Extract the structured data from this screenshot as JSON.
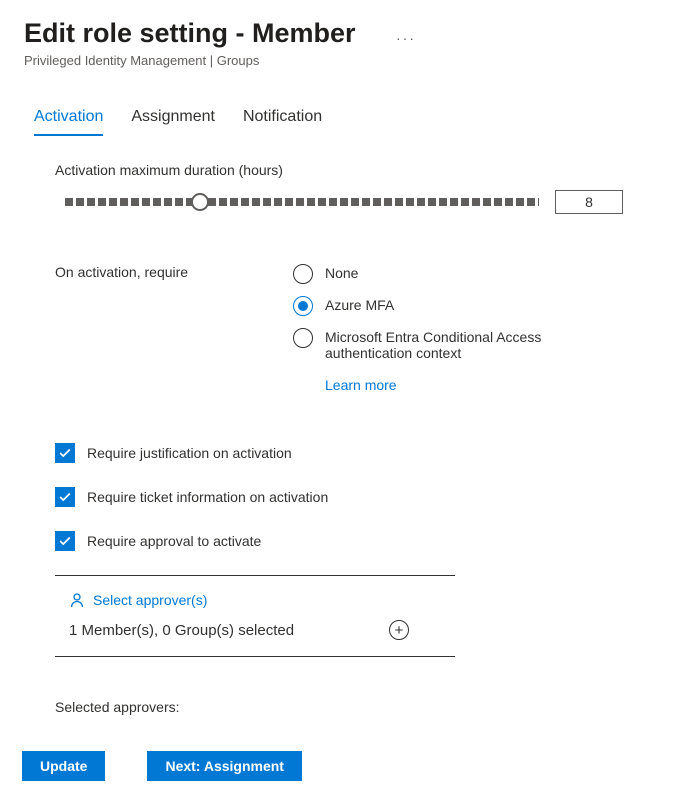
{
  "header": {
    "title": "Edit role setting - Member",
    "subtitle": "Privileged Identity Management | Groups"
  },
  "tabs": {
    "activation": "Activation",
    "assignment": "Assignment",
    "notification": "Notification"
  },
  "activation": {
    "duration_label": "Activation maximum duration (hours)",
    "duration_value": "8",
    "require_label": "On activation, require",
    "options": {
      "none": "None",
      "azure_mfa": "Azure MFA",
      "conditional": "Microsoft Entra Conditional Access authentication context"
    },
    "learn_more": "Learn more",
    "checkboxes": {
      "justification": "Require justification on activation",
      "ticket": "Require ticket information on activation",
      "approval": "Require approval to activate"
    },
    "approvers": {
      "select_label": "Select approver(s)",
      "count_text": "1 Member(s), 0 Group(s) selected",
      "selected_label": "Selected approvers:"
    }
  },
  "footer": {
    "update": "Update",
    "next": "Next: Assignment"
  }
}
